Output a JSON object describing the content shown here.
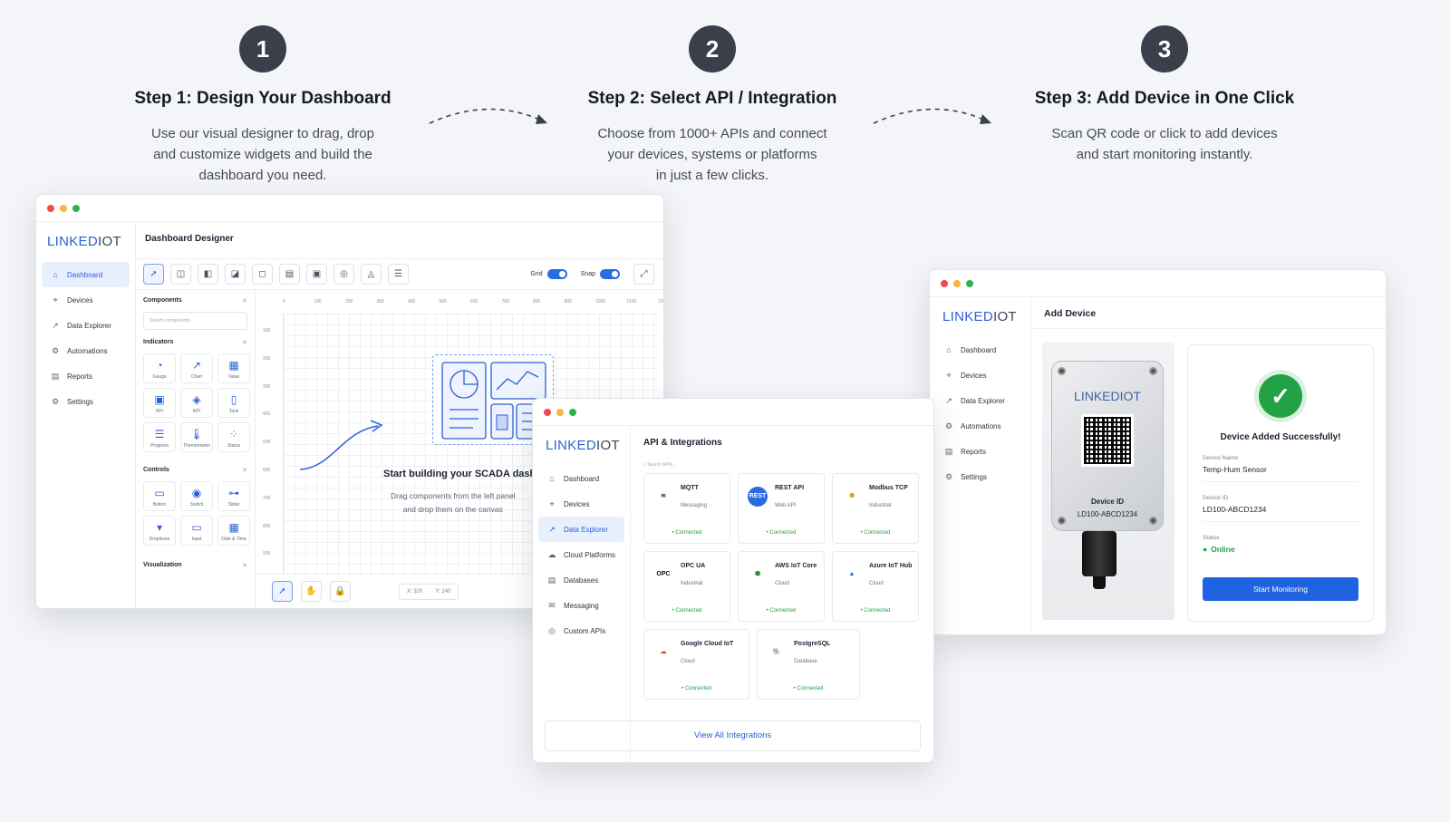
{
  "steps": [
    {
      "number": "1",
      "title": "Step 1: Design Your Dashboard",
      "desc_lines": [
        "Use our visual designer to drag, drop",
        "and customize widgets and build the",
        "dashboard you need."
      ]
    },
    {
      "number": "2",
      "title": "Step 2: Select API / Integration",
      "desc_lines": [
        "Choose from 1000+ APIs and connect",
        "your devices, systems or platforms",
        "in just a few clicks."
      ]
    },
    {
      "number": "3",
      "title": "Step 3: Add Device in One Click",
      "desc_lines": [
        "Scan QR code or click to add devices",
        "and start monitoring instantly."
      ]
    }
  ],
  "brand": {
    "part1": "LINKED",
    "part2": "IOT"
  },
  "designer": {
    "title": "Dashboard Designer",
    "nav": [
      {
        "icon": "⌂",
        "label": "Dashboard"
      },
      {
        "icon": "⌖",
        "label": "Devices"
      },
      {
        "icon": "↗",
        "label": "Data Explorer"
      },
      {
        "icon": "⚙",
        "label": "Automations"
      },
      {
        "icon": "▤",
        "label": "Reports"
      },
      {
        "icon": "⚙",
        "label": "Settings"
      }
    ],
    "grid_label": "Grid",
    "snap_label": "Snap",
    "components_title": "Components",
    "search_placeholder": "Search components...",
    "indicators_title": "Indicators",
    "indicators": [
      {
        "icon": "◔",
        "label": "Gauge"
      },
      {
        "icon": "↗",
        "label": "Chart"
      },
      {
        "icon": "▦",
        "label": "Value"
      },
      {
        "icon": "▣",
        "label": "KPI"
      },
      {
        "icon": "◈",
        "label": "KPI"
      },
      {
        "icon": "▯",
        "label": "Tank"
      },
      {
        "icon": "☰",
        "label": "Progress"
      },
      {
        "icon": "🌡",
        "label": "Thermometer"
      },
      {
        "icon": "⁘",
        "label": "Status"
      }
    ],
    "controls_title": "Controls",
    "controls": [
      {
        "icon": "▭",
        "label": "Button"
      },
      {
        "icon": "◉",
        "label": "Switch"
      },
      {
        "icon": "⊶",
        "label": "Slider"
      },
      {
        "icon": "▾",
        "label": "Dropdown"
      },
      {
        "icon": "▭",
        "label": "Input"
      },
      {
        "icon": "▦",
        "label": "Date & Time"
      }
    ],
    "visualization_title": "Visualization",
    "ruler_x": [
      "0",
      "100",
      "200",
      "300",
      "400",
      "500",
      "600",
      "700",
      "800",
      "900",
      "1000",
      "1100",
      "1200"
    ],
    "ruler_y": [
      "100",
      "200",
      "300",
      "400",
      "500",
      "600",
      "700",
      "800",
      "900"
    ],
    "canvas_title": "Start building your SCADA dashboard",
    "canvas_sub_1": "Drag components from the left panel",
    "canvas_sub_2": "and drop them on the canvas",
    "coord_x": "X:   320",
    "coord_y": "Y:   240"
  },
  "api": {
    "title": "API & Integrations",
    "search_placeholder": "Search APIs...",
    "nav": [
      {
        "icon": "⌂",
        "label": "Dashboard"
      },
      {
        "icon": "⌖",
        "label": "Devices"
      },
      {
        "icon": "↗",
        "label": "Data Explorer"
      },
      {
        "icon": "☁",
        "label": "Cloud Platforms"
      },
      {
        "icon": "▤",
        "label": "Databases"
      },
      {
        "icon": "✉",
        "label": "Messaging"
      },
      {
        "icon": "◎",
        "label": "Custom APIs"
      }
    ],
    "integrations": [
      {
        "name": "MQTT",
        "type": "Messaging",
        "status": "• Connected",
        "logo": "≋",
        "color": "#6a1b7a",
        "bg": "#ffffff"
      },
      {
        "name": "REST API",
        "type": "Web API",
        "status": "• Connected",
        "logo": "REST",
        "color": "#ffffff",
        "bg": "#2b6be0"
      },
      {
        "name": "Modbus TCP",
        "type": "Industrial",
        "status": "• Connected",
        "logo": "✺",
        "color": "#d8a200",
        "bg": "#ffffff"
      },
      {
        "name": "OPC UA",
        "type": "Industrial",
        "status": "• Connected",
        "logo": "OPC",
        "color": "#111111",
        "bg": "#ffffff"
      },
      {
        "name": "AWS IoT Core",
        "type": "Cloud",
        "status": "• Connected",
        "logo": "⬢",
        "color": "#2e8b3a",
        "bg": "#ffffff"
      },
      {
        "name": "Azure IoT Hub",
        "type": "Cloud",
        "status": "• Connected",
        "logo": "▲",
        "color": "#0a6ed1",
        "bg": "#ffffff"
      }
    ],
    "integrations_row2": [
      {
        "name": "Google Cloud IoT",
        "type": "Cloud",
        "status": "• Connected",
        "logo": "☁",
        "color": "#ea4335",
        "bg": "#ffffff"
      },
      {
        "name": "PostgreSQL",
        "type": "Database",
        "status": "• Connected",
        "logo": "🐘",
        "color": "#336791",
        "bg": "#ffffff"
      }
    ],
    "view_all": "View All Integrations"
  },
  "device": {
    "title": "Add Device",
    "nav": [
      {
        "icon": "⌂",
        "label": "Dashboard"
      },
      {
        "icon": "⌖",
        "label": "Devices"
      },
      {
        "icon": "↗",
        "label": "Data Explorer"
      },
      {
        "icon": "⚙",
        "label": "Automations"
      },
      {
        "icon": "▤",
        "label": "Reports"
      },
      {
        "icon": "⚙",
        "label": "Settings"
      }
    ],
    "box_logo": "LINKEDIOT",
    "box_id_label": "Device ID",
    "box_id_value": "LD100-ABCD1234",
    "success_title": "Device Added Successfully!",
    "fields": [
      {
        "key": "Device Name",
        "value": "Temp-Hum Sensor"
      },
      {
        "key": "Device ID",
        "value": "LD100-ABCD1234"
      }
    ],
    "status_key": "Status",
    "status_value": "Online",
    "start_button": "Start Monitoring"
  },
  "colors": {
    "accent": "#2b5fd9",
    "success": "#22a245",
    "step_circle": "#3a3f4a"
  }
}
